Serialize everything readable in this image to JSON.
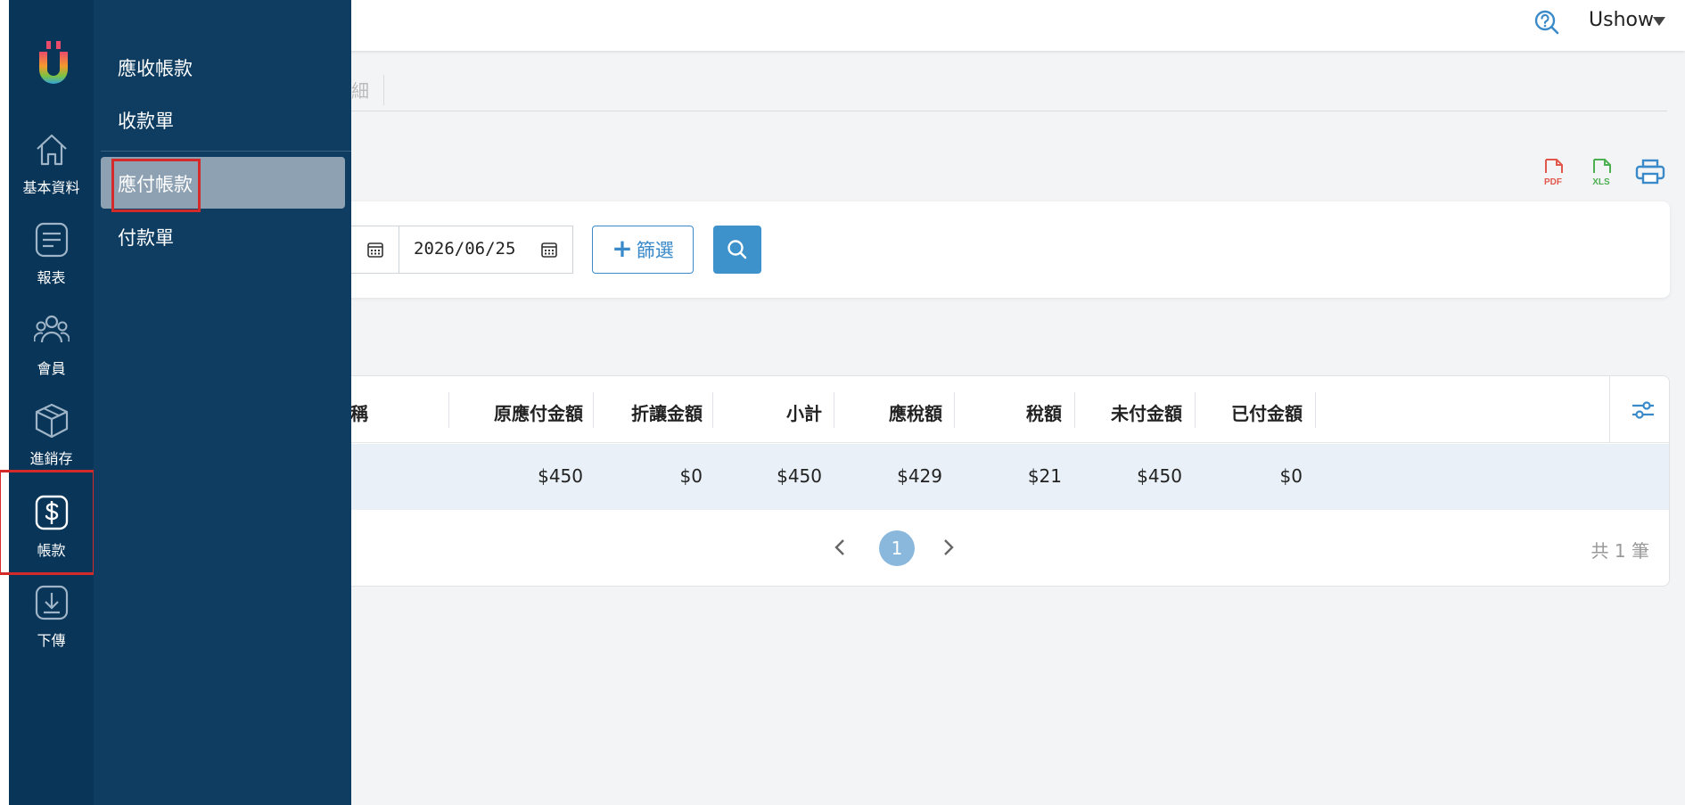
{
  "header": {
    "user_name": "Ushow"
  },
  "tabs": {
    "fragment": "細"
  },
  "filters": {
    "end_date": "2026/06/25",
    "filter_button_label": "篩選"
  },
  "table": {
    "columns": [
      {
        "label": "稱"
      },
      {
        "label": "原應付金額"
      },
      {
        "label": "折讓金額"
      },
      {
        "label": "小計"
      },
      {
        "label": "應稅額"
      },
      {
        "label": "稅額"
      },
      {
        "label": "未付金額"
      },
      {
        "label": "已付金額"
      }
    ],
    "rows": [
      {
        "cells": [
          "$450",
          "$0",
          "$450",
          "$429",
          "$21",
          "$450",
          "$0"
        ]
      }
    ],
    "pagination": {
      "current_page": "1",
      "total_text": "共 1 筆"
    }
  },
  "rail": {
    "items": [
      {
        "label": "基本資料",
        "icon": "home-icon"
      },
      {
        "label": "報表",
        "icon": "report-icon"
      },
      {
        "label": "會員",
        "icon": "members-icon"
      },
      {
        "label": "進銷存",
        "icon": "inventory-box-icon"
      },
      {
        "label": "帳款",
        "icon": "dollar-icon"
      },
      {
        "label": "下傳",
        "icon": "download-icon"
      }
    ]
  },
  "submenu": {
    "items": [
      {
        "label": "應收帳款"
      },
      {
        "label": "收款單"
      },
      {
        "label": "應付帳款"
      },
      {
        "label": "付款單"
      }
    ]
  },
  "colors": {
    "rail_bg": "#083558",
    "submenu_bg": "#0f3d61",
    "submenu_active_bg": "#8ea1b2",
    "accent": "#3d92cc",
    "highlight": "#d42a2a",
    "pdf": "#e2574c",
    "xls": "#4caf50"
  }
}
